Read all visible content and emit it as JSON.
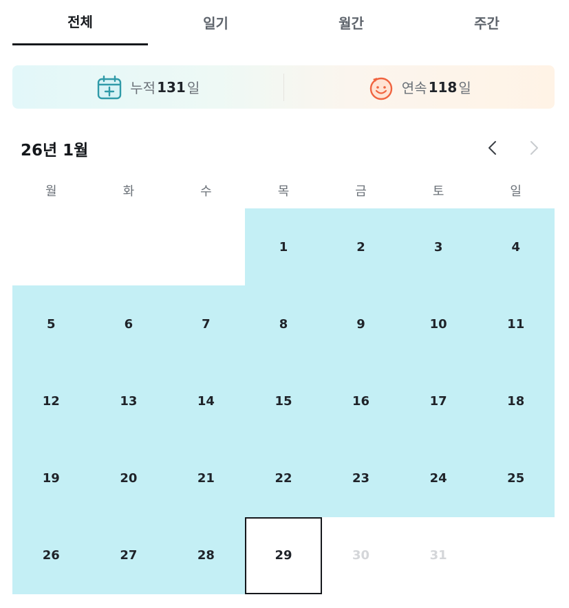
{
  "tabs": [
    {
      "label": "전체",
      "active": true
    },
    {
      "label": "일기",
      "active": false
    },
    {
      "label": "월간",
      "active": false
    },
    {
      "label": "주간",
      "active": false
    }
  ],
  "stats": {
    "cumulative": {
      "label": "누적",
      "value": "131",
      "unit": "일",
      "icon": "calendar-plus-icon"
    },
    "streak": {
      "label": "연속",
      "value": "118",
      "unit": "일",
      "icon": "smiley-face-icon"
    }
  },
  "calendar": {
    "title": "26년 1월",
    "weekdays": [
      "월",
      "화",
      "수",
      "목",
      "금",
      "토",
      "일"
    ],
    "today": 29,
    "filled_days": [
      1,
      2,
      3,
      4,
      5,
      6,
      7,
      8,
      9,
      10,
      11,
      12,
      13,
      14,
      15,
      16,
      17,
      18,
      19,
      20,
      21,
      22,
      23,
      24,
      25,
      26,
      27,
      28
    ],
    "days": [
      "",
      "",
      "",
      "1",
      "2",
      "3",
      "4",
      "5",
      "6",
      "7",
      "8",
      "9",
      "10",
      "11",
      "12",
      "13",
      "14",
      "15",
      "16",
      "17",
      "18",
      "19",
      "20",
      "21",
      "22",
      "23",
      "24",
      "25",
      "26",
      "27",
      "28",
      "29",
      "30",
      "31",
      ""
    ]
  },
  "colors": {
    "filled": "#c4eff5",
    "today_border": "#14171b",
    "future_text": "#d4d6d9",
    "icon_teal": "#2f9aa8",
    "icon_orange": "#f0633f"
  }
}
